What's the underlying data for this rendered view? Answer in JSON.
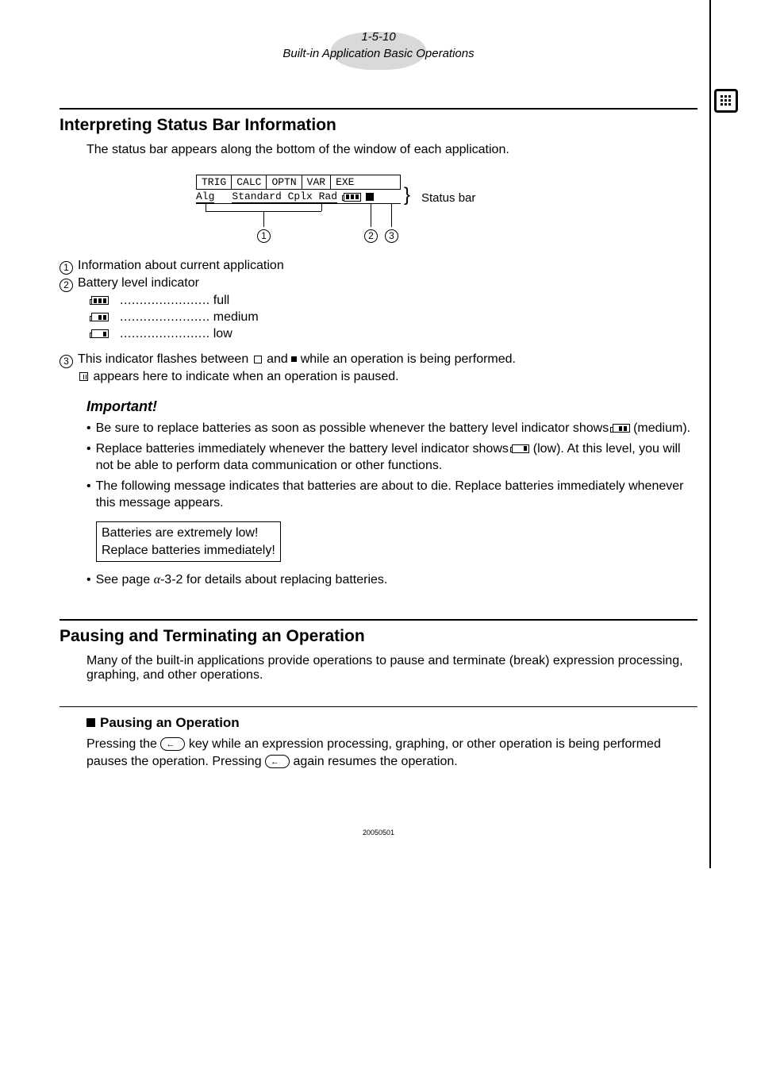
{
  "header": {
    "pagenum": "1-5-10",
    "section": "Built-in Application Basic Operations"
  },
  "h2a": "Interpreting Status Bar Information",
  "intro1": "The status bar appears along the bottom of the window of each application.",
  "status_fig": {
    "tabs": [
      "TRIG",
      "CALC",
      "OPTN",
      "VAR",
      "EXE"
    ],
    "row_left": "Alg",
    "row_right": "Standard Cplx Rad",
    "label": "Status bar"
  },
  "legend1": "Information about current application",
  "legend2": "Battery level indicator",
  "batt_full": "full",
  "batt_med": "medium",
  "batt_low": "low",
  "legend3a": "This indicator flashes between ",
  "legend3b": " and ",
  "legend3c": " while an operation is being performed.",
  "legend3d": " appears here to indicate when an operation is paused.",
  "important": "Important!",
  "bul1a": "Be sure to replace batteries as soon as possible whenever the battery level indicator shows ",
  "bul1b": " (medium).",
  "bul2a": "Replace batteries immediately whenever the battery level indicator shows ",
  "bul2b": " (low). At this level, you will not be able to perform data communication or other functions.",
  "bul3": "The following message indicates that batteries are about to die. Replace batteries immediately whenever this message appears.",
  "msg1": "Batteries are extremely low!",
  "msg2": "Replace batteries immediately!",
  "bul4a": "See page ",
  "bul4b": "-3-2 for details about replacing batteries.",
  "alpha": "α",
  "h2b": "Pausing and Terminating an Operation",
  "intro2": "Many of the built-in applications provide operations to pause and terminate (break) expression processing, graphing, and other operations.",
  "h3": "Pausing an Operation",
  "para_a": "Pressing the ",
  "para_b": " key while an expression processing, graphing, or other operation is being performed pauses the operation. Pressing ",
  "para_c": " again resumes the operation.",
  "footer": "20050501"
}
